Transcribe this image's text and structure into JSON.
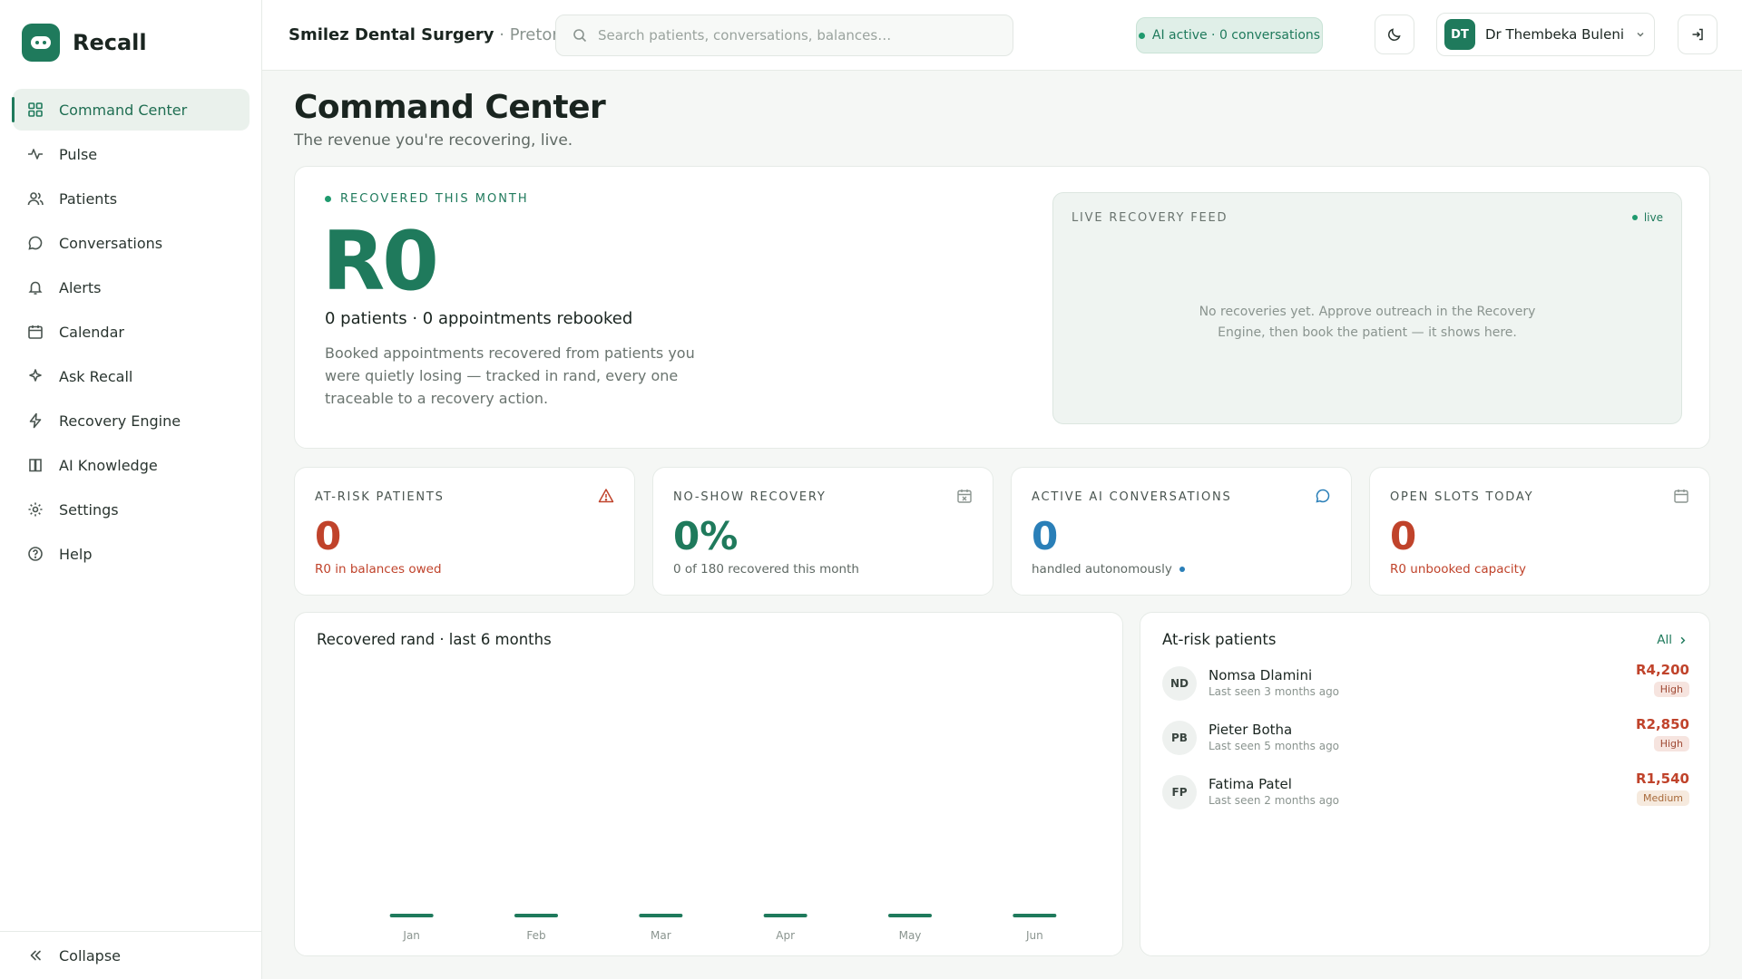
{
  "brand": {
    "name": "Recall"
  },
  "nav": [
    {
      "label": "Command Center",
      "icon": "grid-icon",
      "active": true
    },
    {
      "label": "Pulse",
      "icon": "pulse-icon"
    },
    {
      "label": "Patients",
      "icon": "users-icon"
    },
    {
      "label": "Conversations",
      "icon": "chat-icon"
    },
    {
      "label": "Alerts",
      "icon": "bell-icon"
    },
    {
      "label": "Calendar",
      "icon": "calendar-icon"
    },
    {
      "label": "Ask Recall",
      "icon": "sparkle-icon"
    },
    {
      "label": "Recovery Engine",
      "icon": "bolt-icon"
    },
    {
      "label": "AI Knowledge",
      "icon": "book-icon"
    },
    {
      "label": "Settings",
      "icon": "gear-icon"
    },
    {
      "label": "Help",
      "icon": "help-icon"
    }
  ],
  "collapse_label": "Collapse",
  "header": {
    "clinic_name": "Smilez Dental Surgery",
    "clinic_sep": " · ",
    "clinic_location": "Pretoria",
    "search_placeholder": "Search patients, conversations, balances…",
    "ai_status": "AI active · 0 conversations",
    "user_initials": "DT",
    "user_name": "Dr Thembeka Buleni"
  },
  "page": {
    "title": "Command Center",
    "subtitle": "The revenue you're recovering, live."
  },
  "hero": {
    "label": "RECOVERED THIS MONTH",
    "value": "R0",
    "stats": "0 patients · 0 appointments rebooked",
    "description": "Booked appointments recovered from patients you were quietly losing — tracked in rand, every one traceable to a recovery action."
  },
  "feed": {
    "title": "LIVE RECOVERY FEED",
    "live_label": "live",
    "empty_text": "No recoveries yet. Approve outreach in the Recovery Engine, then book the patient — it shows here."
  },
  "stats": [
    {
      "label": "AT-RISK PATIENTS",
      "icon": "warning-icon",
      "value": "0",
      "foot": "R0 in balances owed",
      "color": "#c0432b",
      "foot_color": "#c0432b"
    },
    {
      "label": "NO-SHOW RECOVERY",
      "icon": "calendar-x-icon",
      "value": "0%",
      "foot": "0 of 180 recovered this month",
      "color": "#1f7a5c",
      "foot_color": "#5f6964"
    },
    {
      "label": "ACTIVE AI CONVERSATIONS",
      "icon": "chat-icon",
      "value": "0",
      "foot": "handled autonomously",
      "color": "#2a7fb8",
      "foot_color": "#5f6964"
    },
    {
      "label": "OPEN SLOTS TODAY",
      "icon": "calendar-icon",
      "value": "0",
      "foot": "R0 unbooked capacity",
      "color": "#c0432b",
      "foot_color": "#c0432b"
    }
  ],
  "chart_data": {
    "type": "bar",
    "title": "Recovered rand · last 6 months",
    "categories": [
      "Jan",
      "Feb",
      "Mar",
      "Apr",
      "May",
      "Jun"
    ],
    "values": [
      0,
      0,
      0,
      0,
      0,
      0
    ],
    "bar_color": "#1f7a5c"
  },
  "at_risk": {
    "title": "At-risk patients",
    "all_label": "All",
    "patients": [
      {
        "initials": "ND",
        "name": "Nomsa Dlamini",
        "last_seen": "Last seen 3 months ago",
        "amount": "R4,200",
        "level": "High"
      },
      {
        "initials": "PB",
        "name": "Pieter Botha",
        "last_seen": "Last seen 5 months ago",
        "amount": "R2,850",
        "level": "High"
      },
      {
        "initials": "FP",
        "name": "Fatima Patel",
        "last_seen": "Last seen 2 months ago",
        "amount": "R1,540",
        "level": "Medium"
      }
    ]
  }
}
